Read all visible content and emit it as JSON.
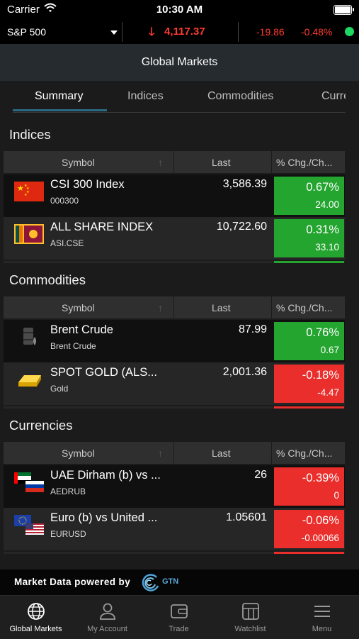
{
  "status_bar": {
    "carrier": "Carrier",
    "time": "10:30 AM"
  },
  "ticker": {
    "symbol": "S&P 500",
    "arrow": "🡓",
    "price": "4,117.37",
    "change": "-19.86",
    "change_pct": "-0.48%"
  },
  "header": {
    "title": "Global Markets"
  },
  "tabs": [
    "Summary",
    "Indices",
    "Commodities",
    "Currencies"
  ],
  "columns": {
    "symbol": "Symbol",
    "last": "Last",
    "change": "% Chg./Ch..."
  },
  "sections": [
    {
      "title": "Indices",
      "rows": [
        {
          "name": "CSI 300 Index",
          "code": "000300",
          "last": "3,586.39",
          "pct": "0.67%",
          "chg": "24.00",
          "direction": "up",
          "flag": "china-flag"
        },
        {
          "name": "ALL SHARE INDEX",
          "code": "ASI.CSE",
          "last": "10,722.60",
          "pct": "0.31%",
          "chg": "33.10",
          "direction": "up",
          "flag": "sri-lanka-flag"
        }
      ]
    },
    {
      "title": "Commodities",
      "rows": [
        {
          "name": "Brent Crude",
          "code": "Brent Crude",
          "last": "87.99",
          "pct": "0.76%",
          "chg": "0.67",
          "direction": "up",
          "flag": "oil-barrel-icon"
        },
        {
          "name": "SPOT GOLD (ALS...",
          "code": "Gold",
          "last": "2,001.36",
          "pct": "-0.18%",
          "chg": "-4.47",
          "direction": "down",
          "flag": "gold-bar-icon"
        }
      ]
    },
    {
      "title": "Currencies",
      "rows": [
        {
          "name": "UAE Dirham (b) vs ...",
          "code": "AEDRUB",
          "last": "26",
          "pct": "-0.39%",
          "chg": "0",
          "direction": "down",
          "flag": "uae-russia-flags"
        },
        {
          "name": "Euro (b) vs United ...",
          "code": "EURUSD",
          "last": "1.05601",
          "pct": "-0.06%",
          "chg": "-0.00066",
          "direction": "down",
          "flag": "eu-us-flags"
        }
      ]
    }
  ],
  "colors": {
    "up": "#24a52f",
    "down": "#ea2e2b",
    "ticker_down": "#ff3b30",
    "live_dot": "#1ed760",
    "tab_underline": "#2d6a86"
  },
  "powered_by": {
    "text": "Market Data powered by",
    "brand": "GTN"
  },
  "nav": [
    {
      "label": "Global Markets",
      "icon": "globe-icon",
      "active": true
    },
    {
      "label": "My Account",
      "icon": "person-icon",
      "active": false
    },
    {
      "label": "Trade",
      "icon": "wallet-icon",
      "active": false
    },
    {
      "label": "Watchlist",
      "icon": "grid-icon",
      "active": false
    },
    {
      "label": "Menu",
      "icon": "hamburger-icon",
      "active": false
    }
  ]
}
